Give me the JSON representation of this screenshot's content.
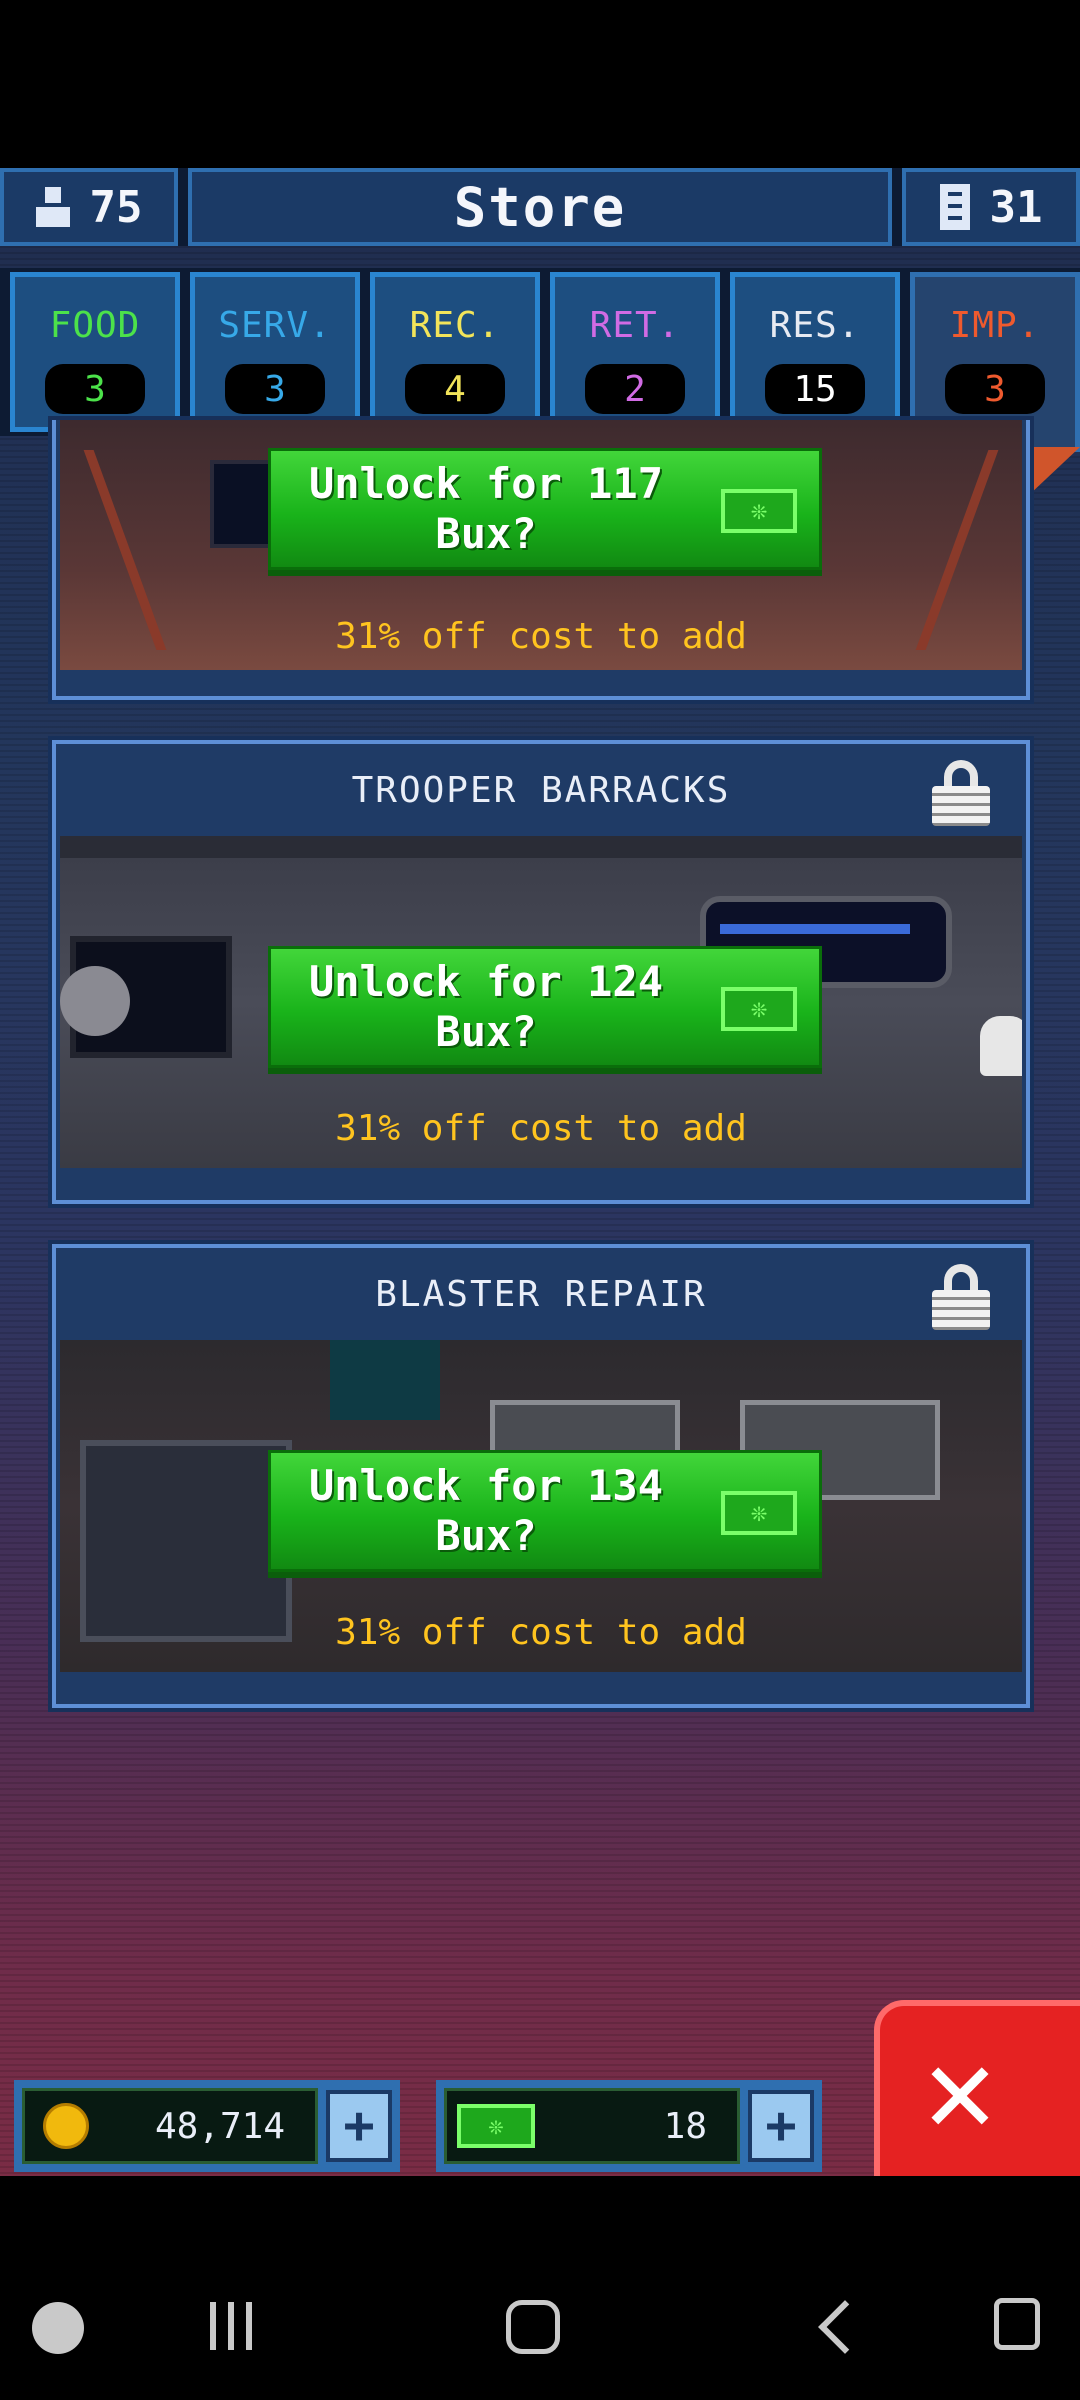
{
  "header": {
    "population": "75",
    "title": "Store",
    "floors": "31"
  },
  "tabs": [
    {
      "label": "FOOD",
      "count": "3",
      "color": "#4ce24a"
    },
    {
      "label": "SERV.",
      "count": "3",
      "color": "#37a9e8"
    },
    {
      "label": "REC.",
      "count": "4",
      "color": "#f2e45a"
    },
    {
      "label": "RET.",
      "count": "2",
      "color": "#d16be4"
    },
    {
      "label": "RES.",
      "count": "15",
      "color": "#e7eaf2"
    },
    {
      "label": "IMP.",
      "count": "3",
      "color": "#ef5a2e",
      "active": true
    }
  ],
  "rooms": [
    {
      "name": "",
      "unlock_label": "Unlock for 117 Bux?",
      "discount": "31% off cost to add"
    },
    {
      "name": "TROOPER BARRACKS",
      "unlock_label": "Unlock for 124 Bux?",
      "discount": "31% off cost to add"
    },
    {
      "name": "BLASTER REPAIR",
      "unlock_label": "Unlock for 134 Bux?",
      "discount": "31% off cost to add"
    }
  ],
  "currency": {
    "coins": "48,714",
    "bux": "18"
  },
  "icons": {
    "population": "person-icon",
    "floors": "building-icon",
    "lock": "lock-icon",
    "bux": "bux-icon",
    "coin": "coin-icon",
    "close": "close-icon"
  }
}
